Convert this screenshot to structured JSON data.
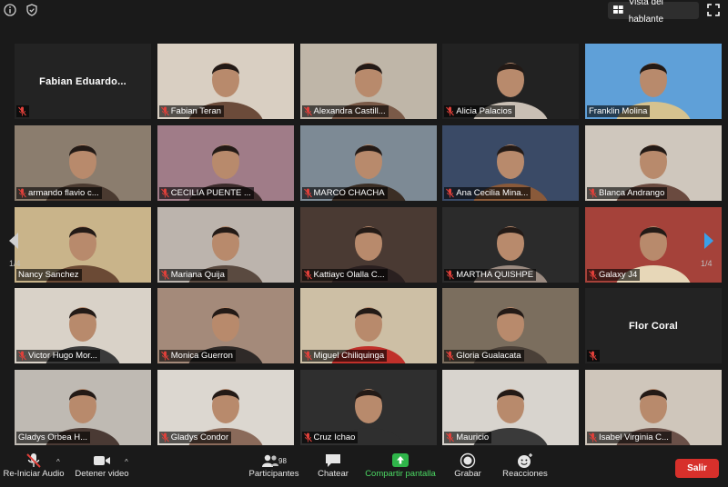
{
  "header": {
    "view_button_label": "Vista del hablante"
  },
  "colors": {
    "active_speaker_border": "#c8d84a",
    "muted_icon": "#e0403a",
    "nav_arrow": "#3aa0e8",
    "share_green": "#2fb54a",
    "exit_red": "#d7302b"
  },
  "gallery": {
    "page_left": "1/4",
    "page_right": "1/4",
    "participants": [
      {
        "name": "Fabian  Eduardo...",
        "video": false,
        "muted": true,
        "active": false
      },
      {
        "name": "Fabian Teran",
        "video": true,
        "muted": true,
        "active": false
      },
      {
        "name": "Alexandra Castill...",
        "video": true,
        "muted": true,
        "active": false
      },
      {
        "name": "Alicia Palacios",
        "video": true,
        "muted": true,
        "active": false
      },
      {
        "name": "Franklin Molina",
        "video": true,
        "muted": false,
        "active": true
      },
      {
        "name": "armando flavio c...",
        "video": true,
        "muted": true,
        "active": false
      },
      {
        "name": "CECILIA PUENTE ...",
        "video": true,
        "muted": true,
        "active": false
      },
      {
        "name": "MARCO CHACHA",
        "video": true,
        "muted": true,
        "active": false
      },
      {
        "name": "Ana Cecilia Mina...",
        "video": true,
        "muted": true,
        "active": false
      },
      {
        "name": "Blanca Andrango",
        "video": true,
        "muted": true,
        "active": false
      },
      {
        "name": "Nancy Sanchez",
        "video": true,
        "muted": false,
        "active": false
      },
      {
        "name": "Mariana Quija",
        "video": true,
        "muted": true,
        "active": false
      },
      {
        "name": "Kattiayc Olalla C...",
        "video": true,
        "muted": true,
        "active": false
      },
      {
        "name": "MARTHA QUISHPE",
        "video": true,
        "muted": true,
        "active": false
      },
      {
        "name": "Galaxy J4",
        "video": true,
        "muted": true,
        "active": false
      },
      {
        "name": "Victor Hugo Mor...",
        "video": true,
        "muted": true,
        "active": false
      },
      {
        "name": "Monica Guerron",
        "video": true,
        "muted": true,
        "active": false
      },
      {
        "name": "Miguel Chiliquinga",
        "video": true,
        "muted": true,
        "active": false
      },
      {
        "name": "Gloria Gualacata",
        "video": true,
        "muted": true,
        "active": false
      },
      {
        "name": "Flor Coral",
        "video": false,
        "muted": true,
        "active": false
      },
      {
        "name": "Gladys Orbea H...",
        "video": true,
        "muted": false,
        "active": false
      },
      {
        "name": "Gladys Condor",
        "video": true,
        "muted": true,
        "active": false
      },
      {
        "name": "Cruz Ichao",
        "video": true,
        "muted": true,
        "active": false
      },
      {
        "name": "Mauricio",
        "video": true,
        "muted": true,
        "active": false
      },
      {
        "name": "Isabel Virginia C...",
        "video": true,
        "muted": true,
        "active": false
      }
    ]
  },
  "toolbar": {
    "audio_label": "Re-Iniciar Audio",
    "video_label": "Detener video",
    "participants_label": "Participantes",
    "participants_count": "98",
    "chat_label": "Chatear",
    "share_label": "Compartir pantalla",
    "record_label": "Grabar",
    "reactions_label": "Reacciones",
    "exit_label": "Salir"
  }
}
